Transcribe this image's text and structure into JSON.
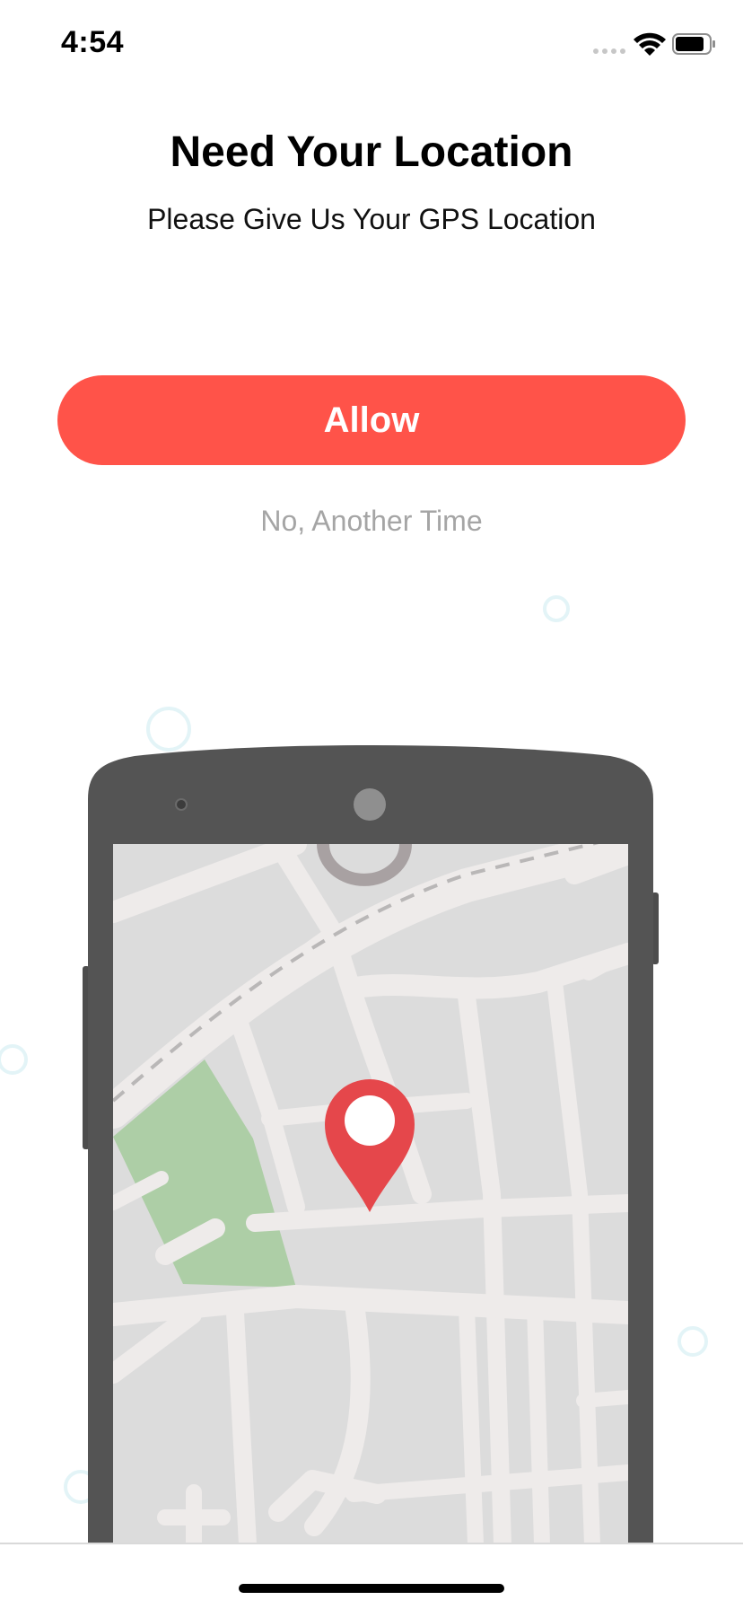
{
  "status_bar": {
    "time": "4:54",
    "icons": [
      "signal-icon",
      "wifi-icon",
      "battery-icon"
    ]
  },
  "header": {
    "title": "Need Your Location",
    "subtitle": "Please Give Us Your GPS Location"
  },
  "actions": {
    "allow_label": "Allow",
    "decline_label": "No, Another Time"
  },
  "illustration": {
    "icons": [
      "phone-illustration",
      "map-illustration",
      "location-pin-icon"
    ]
  },
  "colors": {
    "accent": "#FF5349",
    "secondary_text": "#A5A5A5",
    "phone_body": "#545454",
    "map_block": "#DCDCDC",
    "map_road": "#EEEBEA",
    "park": "#ADCEA6",
    "pin": "#E5474B",
    "bubble": "#E3F4F7"
  }
}
